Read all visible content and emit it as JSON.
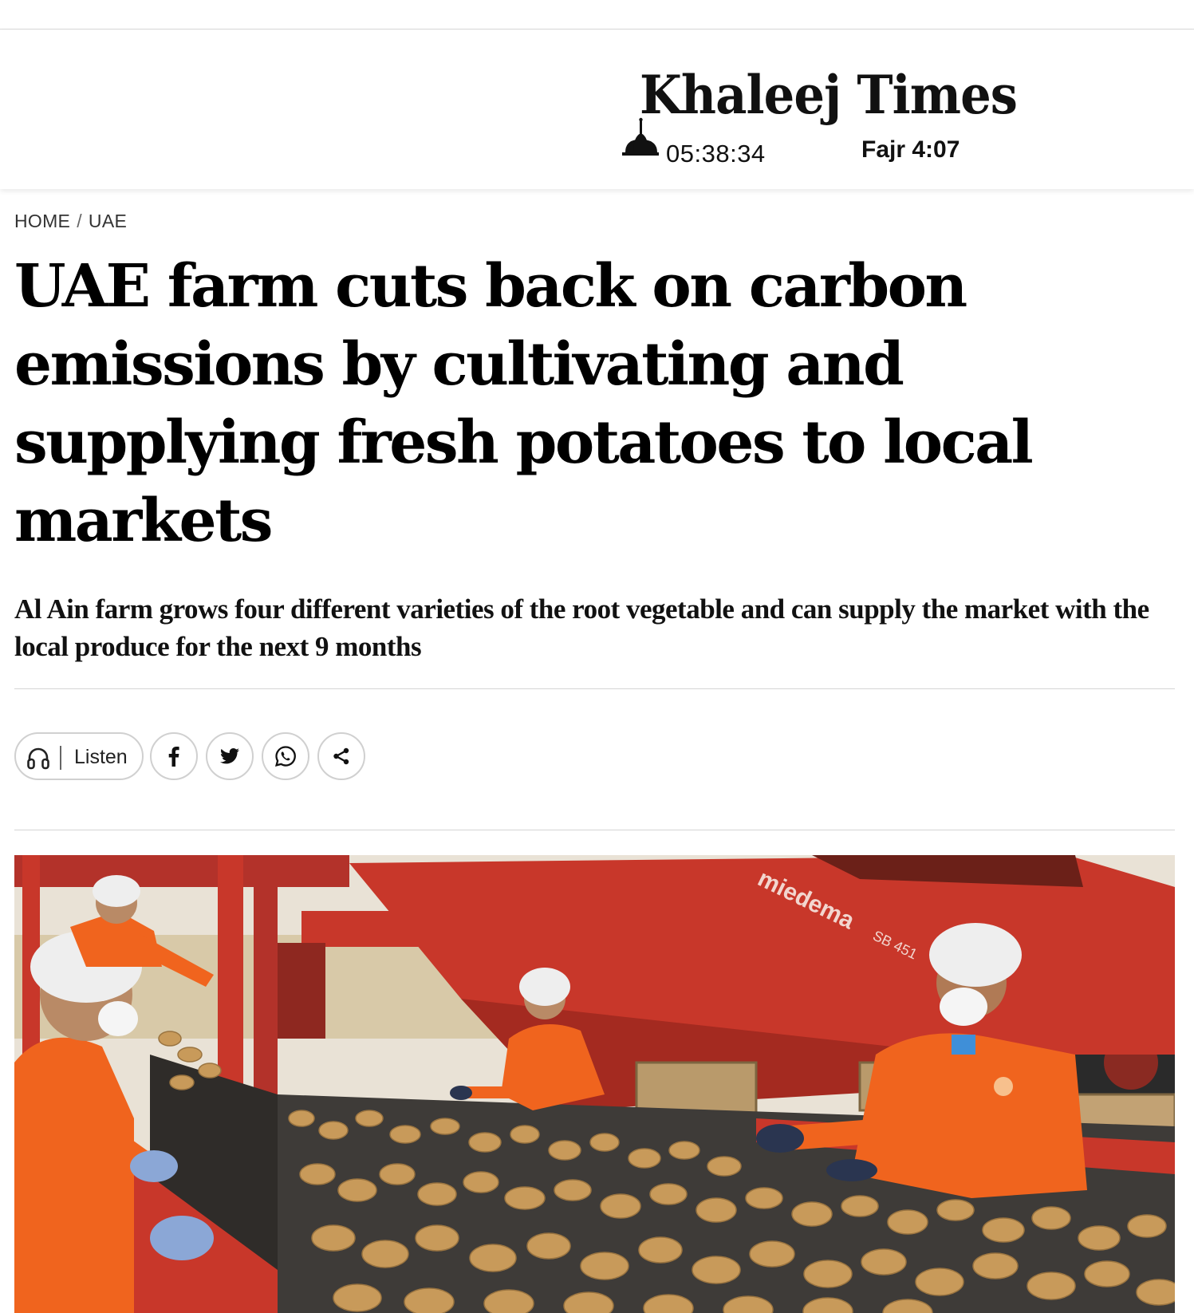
{
  "header": {
    "logo_text": "Khaleej Times",
    "clock": "05:38:34",
    "prayer": "Fajr 4:07"
  },
  "breadcrumb": {
    "home": "HOME",
    "separator": "/",
    "section": "UAE"
  },
  "article": {
    "headline": "UAE farm cuts back on carbon emissions by cultivating and supplying fresh potatoes to local markets",
    "subhead": "Al Ain farm grows four different varieties of the root vegetable and can supply the market with the local produce for the next 9 months"
  },
  "share": {
    "listen_label": "Listen",
    "icons": [
      "headphones-icon",
      "facebook-icon",
      "twitter-icon",
      "whatsapp-icon",
      "share-icon"
    ]
  },
  "photo": {
    "machine_brand": "miedema",
    "machine_model": "SB 451"
  },
  "colors": {
    "machine_red": "#c8372a",
    "uniform_orange": "#f0641e",
    "potato": "#c89a5a",
    "sky": "#e9e2d6"
  }
}
